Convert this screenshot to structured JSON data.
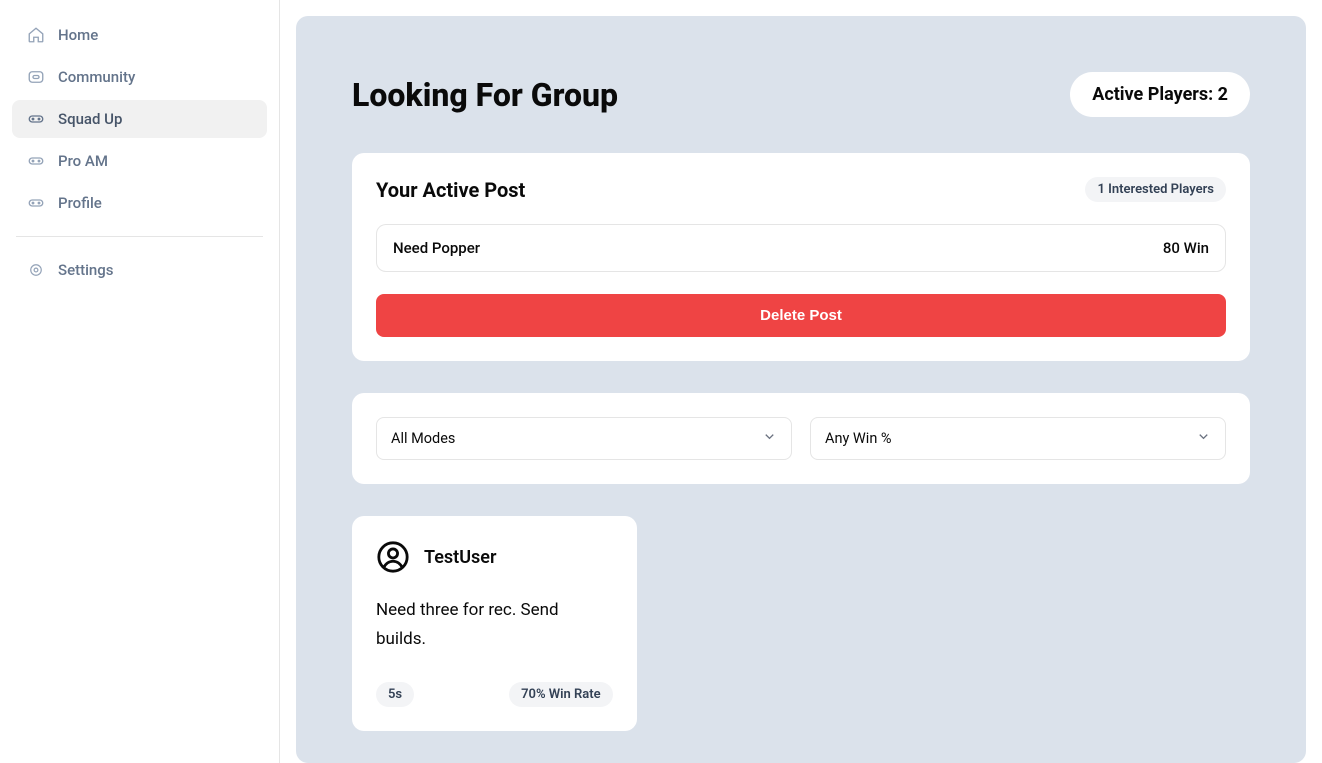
{
  "sidebar": {
    "items": [
      {
        "label": "Home",
        "icon": "home"
      },
      {
        "label": "Community",
        "icon": "square"
      },
      {
        "label": "Squad Up",
        "icon": "gamepad"
      },
      {
        "label": "Pro AM",
        "icon": "gamepad"
      },
      {
        "label": "Profile",
        "icon": "gamepad"
      }
    ],
    "settings_label": "Settings"
  },
  "header": {
    "title": "Looking For Group",
    "active_players_label": "Active Players: 2"
  },
  "active_post": {
    "title": "Your Active Post",
    "interested_label": "1 Interested Players",
    "post_text": "Need Popper",
    "post_win": "80 Win",
    "delete_label": "Delete Post"
  },
  "filters": {
    "mode_label": "All Modes",
    "win_label": "Any Win %"
  },
  "posts": [
    {
      "user": "TestUser",
      "body": "Need three for rec. Send builds.",
      "mode": "5s",
      "winrate": "70% Win Rate"
    }
  ]
}
